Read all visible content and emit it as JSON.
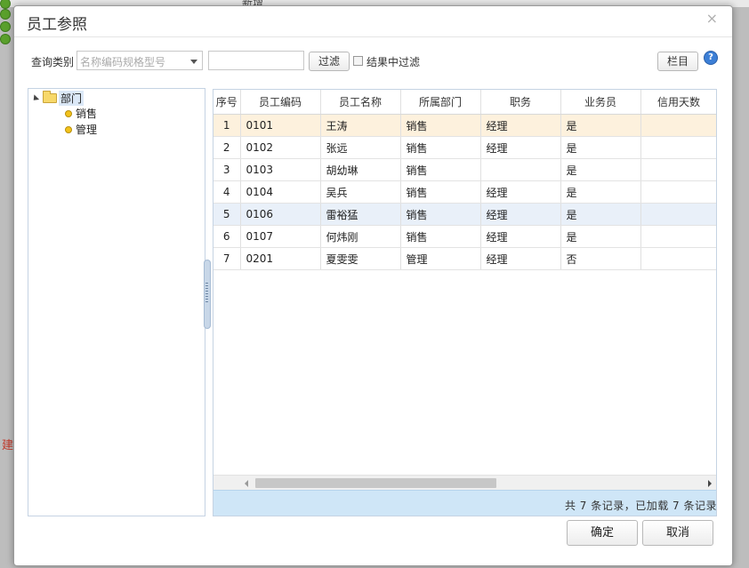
{
  "dialog": {
    "title": "员工参照",
    "close_glyph": "×"
  },
  "toolbar": {
    "query_type_label": "查询类别",
    "query_type_placeholder": "名称编码规格型号",
    "filter_input_value": "",
    "filter_button": "过滤",
    "filter_in_results_label": "结果中过滤",
    "filter_in_results_checked": false,
    "columns_button": "栏目",
    "help_glyph": "?"
  },
  "tree": {
    "root_label": "部门",
    "expanded": true,
    "children": [
      "销售",
      "管理"
    ]
  },
  "grid": {
    "columns": [
      "序号",
      "员工编码",
      "员工名称",
      "所属部门",
      "职务",
      "业务员",
      "信用天数"
    ],
    "rows": [
      {
        "idx": "1",
        "code": "0101",
        "name": "王涛",
        "dept": "销售",
        "title": "经理",
        "salesman": "是",
        "credit_days": ""
      },
      {
        "idx": "2",
        "code": "0102",
        "name": "张远",
        "dept": "销售",
        "title": "经理",
        "salesman": "是",
        "credit_days": ""
      },
      {
        "idx": "3",
        "code": "0103",
        "name": "胡幼琳",
        "dept": "销售",
        "title": "",
        "salesman": "是",
        "credit_days": ""
      },
      {
        "idx": "4",
        "code": "0104",
        "name": "吴兵",
        "dept": "销售",
        "title": "经理",
        "salesman": "是",
        "credit_days": ""
      },
      {
        "idx": "5",
        "code": "0106",
        "name": "雷裕猛",
        "dept": "销售",
        "title": "经理",
        "salesman": "是",
        "credit_days": ""
      },
      {
        "idx": "6",
        "code": "0107",
        "name": "何炜刚",
        "dept": "销售",
        "title": "经理",
        "salesman": "是",
        "credit_days": ""
      },
      {
        "idx": "7",
        "code": "0201",
        "name": "夏雯雯",
        "dept": "管理",
        "title": "经理",
        "salesman": "否",
        "credit_days": ""
      }
    ],
    "selected_row": 1,
    "hovered_row": 5,
    "status": "共 7 条记录，已加载 7 条记录"
  },
  "buttons": {
    "ok": "确定",
    "cancel": "取消"
  },
  "background": {
    "tab_fragment": "新增",
    "red_fragment": "建"
  },
  "colors": {
    "selected_row": "#fdf1dd",
    "hover_row": "#e9f0f9",
    "footer_bg": "#cfe6f7",
    "tree_node_dot": "#f3c21b",
    "help_icon": "#3c7fd6"
  }
}
